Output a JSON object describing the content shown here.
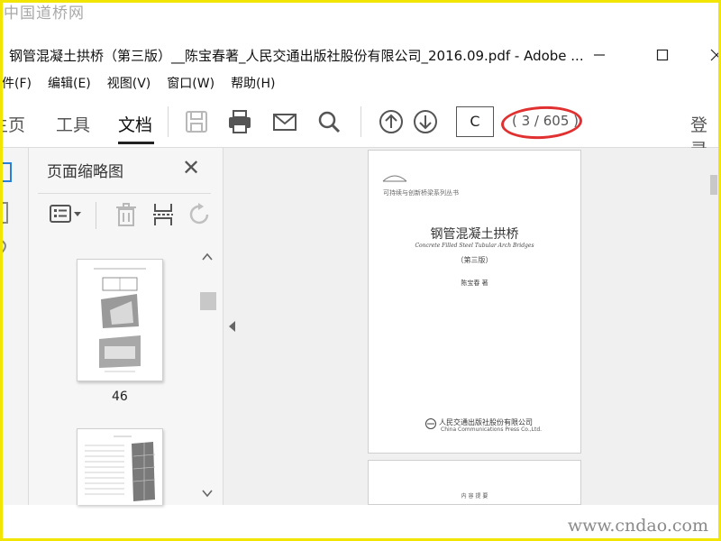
{
  "watermarks": {
    "top": "中国道桥网",
    "bottom": "www.cndao.com"
  },
  "window": {
    "title": "钢管混凝土拱桥（第三版）__陈宝春著_人民交通出版社股份有限公司_2016.09.pdf - Adobe ..."
  },
  "menu": [
    "件(F)",
    "编辑(E)",
    "视图(V)",
    "窗口(W)",
    "帮助(H)"
  ],
  "toolbar": {
    "tabs": [
      "主页",
      "工具",
      "文档"
    ],
    "active_tab": "文档",
    "page_input_value": "C",
    "page_total": "( 3 / 605 )",
    "login": "登录",
    "icons": [
      "save-icon",
      "print-icon",
      "email-icon",
      "search-icon",
      "page-up-icon",
      "page-down-icon"
    ]
  },
  "panel": {
    "title": "页面缩略图",
    "thumbnail_label": "46",
    "icons": [
      "options-icon",
      "delete-icon",
      "insert-page-icon",
      "rotate-icon",
      "close-icon"
    ]
  },
  "document": {
    "series": "可持续与创新桥梁系列丛书",
    "title": "钢管混凝土拱桥",
    "subtitle_en": "Concrete Filled Steel Tubular Arch Bridges",
    "edition": "（第三版）",
    "author": "陈宝春  著",
    "publisher_cn": "人民交通出版社股份有限公司",
    "publisher_en": "China Communications Press Co.,Ltd.",
    "page2_text": "内 容 提 要"
  },
  "colors": {
    "border": "#f2e600",
    "highlight_oval": "#e03030"
  }
}
